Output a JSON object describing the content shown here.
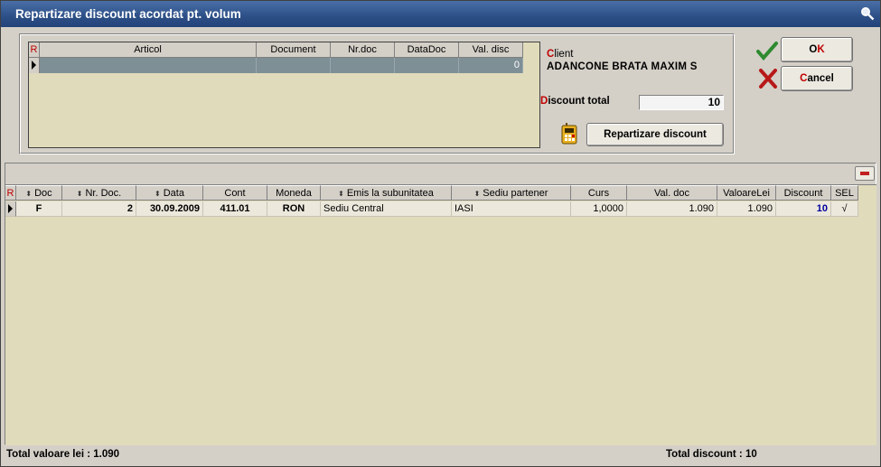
{
  "window": {
    "title": "Repartizare discount acordat pt. volum"
  },
  "articles": {
    "columns": [
      "R",
      "Articol",
      "Document",
      "Nr.doc",
      "DataDoc",
      "Val. disc"
    ],
    "row": {
      "val_disc": "0"
    }
  },
  "client": {
    "label_first": "C",
    "label_rest": "lient",
    "name": "ADANCONE BRATA MAXIM S"
  },
  "discount": {
    "label_first": "D",
    "label_rest": "iscount total",
    "value": "10"
  },
  "buttons": {
    "repartizare": "Repartizare discount",
    "ok_first": "O",
    "ok_rest": "K",
    "cancel_first": "C",
    "cancel_rest": "ancel"
  },
  "docs": {
    "columns": [
      "R",
      "Doc",
      "Nr. Doc.",
      "Data",
      "Cont",
      "Moneda",
      "Emis la subunitatea",
      "Sediu partener",
      "Curs",
      "Val. doc",
      "ValoareLei",
      "Discount",
      "SEL"
    ],
    "rows": [
      {
        "doc": "F",
        "nr_doc": "2",
        "data": "30.09.2009",
        "cont": "411.01",
        "moneda": "RON",
        "emis": "Sediu Central",
        "sediu": "IASI",
        "curs": "1,0000",
        "val_doc": "1.090",
        "valoare_lei": "1.090",
        "discount": "10",
        "sel": "√"
      }
    ]
  },
  "footer": {
    "total_valoare": "Total valoare lei : 1.090",
    "total_discount": "Total discount : 10"
  },
  "colors": {
    "titlebar": "#2c4f86",
    "grid_bg": "#e0dbbb",
    "selected_row": "#7e8f96",
    "accent_red": "#c00000",
    "discount_blue": "#0000a0"
  }
}
